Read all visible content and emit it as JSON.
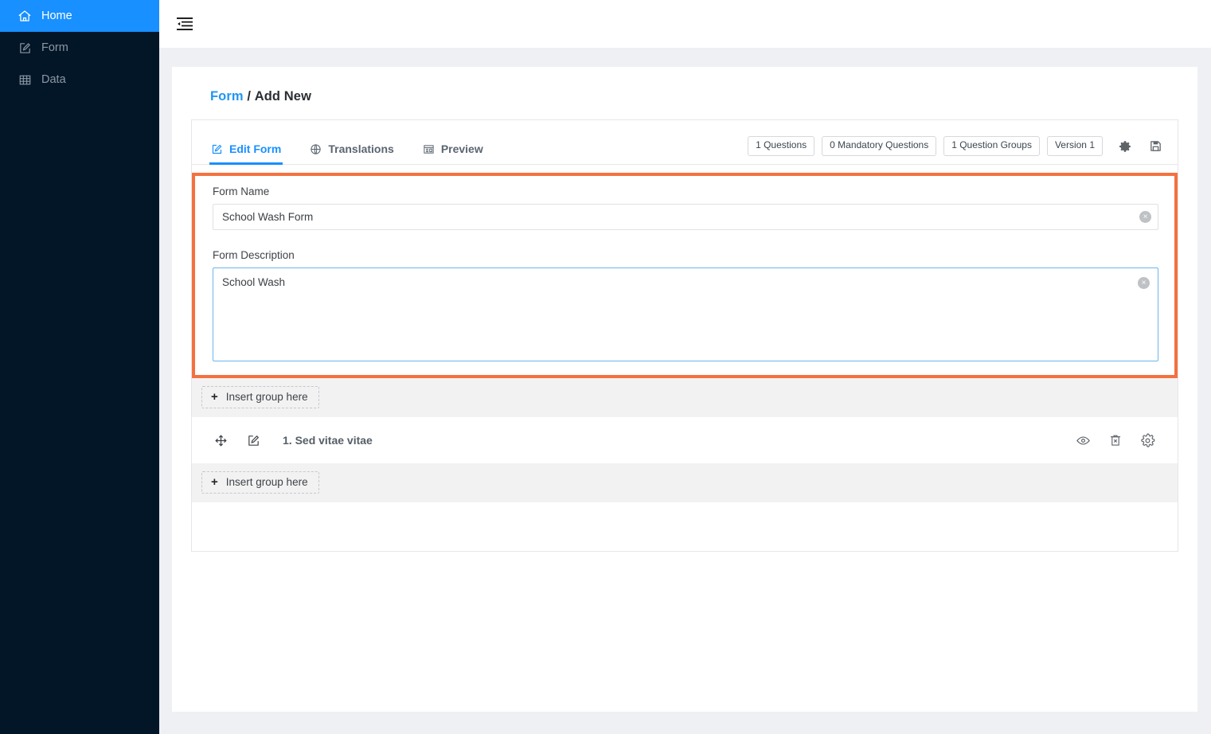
{
  "colors": {
    "sidebar_bg": "#031628",
    "sidebar_active": "#1890ff",
    "accent_blue": "#1890ff",
    "highlight_orange": "#f4713f",
    "page_bg": "#eef0f4",
    "focus_border": "#6cb6ee"
  },
  "sidebar": {
    "items": [
      {
        "label": "Home",
        "icon": "home-icon",
        "active": true
      },
      {
        "label": "Form",
        "icon": "form-edit-icon",
        "active": false
      },
      {
        "label": "Data",
        "icon": "table-grid-icon",
        "active": false
      }
    ]
  },
  "topbar": {
    "collapse_icon": "collapse-sidebar-icon"
  },
  "breadcrumb": {
    "root": "Form",
    "separator": "/",
    "current": "Add New"
  },
  "tabs": [
    {
      "label": "Edit Form",
      "icon": "pencil-square-icon",
      "active": true
    },
    {
      "label": "Translations",
      "icon": "globe-icon",
      "active": false
    },
    {
      "label": "Preview",
      "icon": "preview-window-icon",
      "active": false
    }
  ],
  "tab_actions": {
    "badges": [
      "1 Questions",
      "0 Mandatory Questions",
      "1 Question Groups",
      "Version 1"
    ],
    "settings_icon": "gear-icon",
    "save_icon": "floppy-save-icon"
  },
  "form": {
    "name_label": "Form Name",
    "name_value": "School Wash Form",
    "name_placeholder": "Form Name",
    "description_label": "Form Description",
    "description_value": "School Wash",
    "description_placeholder": "Form Description",
    "clear_glyph": "×"
  },
  "groups": {
    "insert_top_label": "Insert group here",
    "insert_bottom_label": "Insert group here",
    "plus_glyph": "+"
  },
  "question": {
    "title": "1. Sed vitae vitae",
    "drag_icon": "move-arrows-icon",
    "edit_icon": "pencil-square-icon",
    "actions": [
      {
        "name": "preview-question",
        "icon": "eye-icon"
      },
      {
        "name": "delete-question",
        "icon": "trash-x-icon"
      },
      {
        "name": "question-settings",
        "icon": "gear-outline-icon"
      }
    ]
  }
}
